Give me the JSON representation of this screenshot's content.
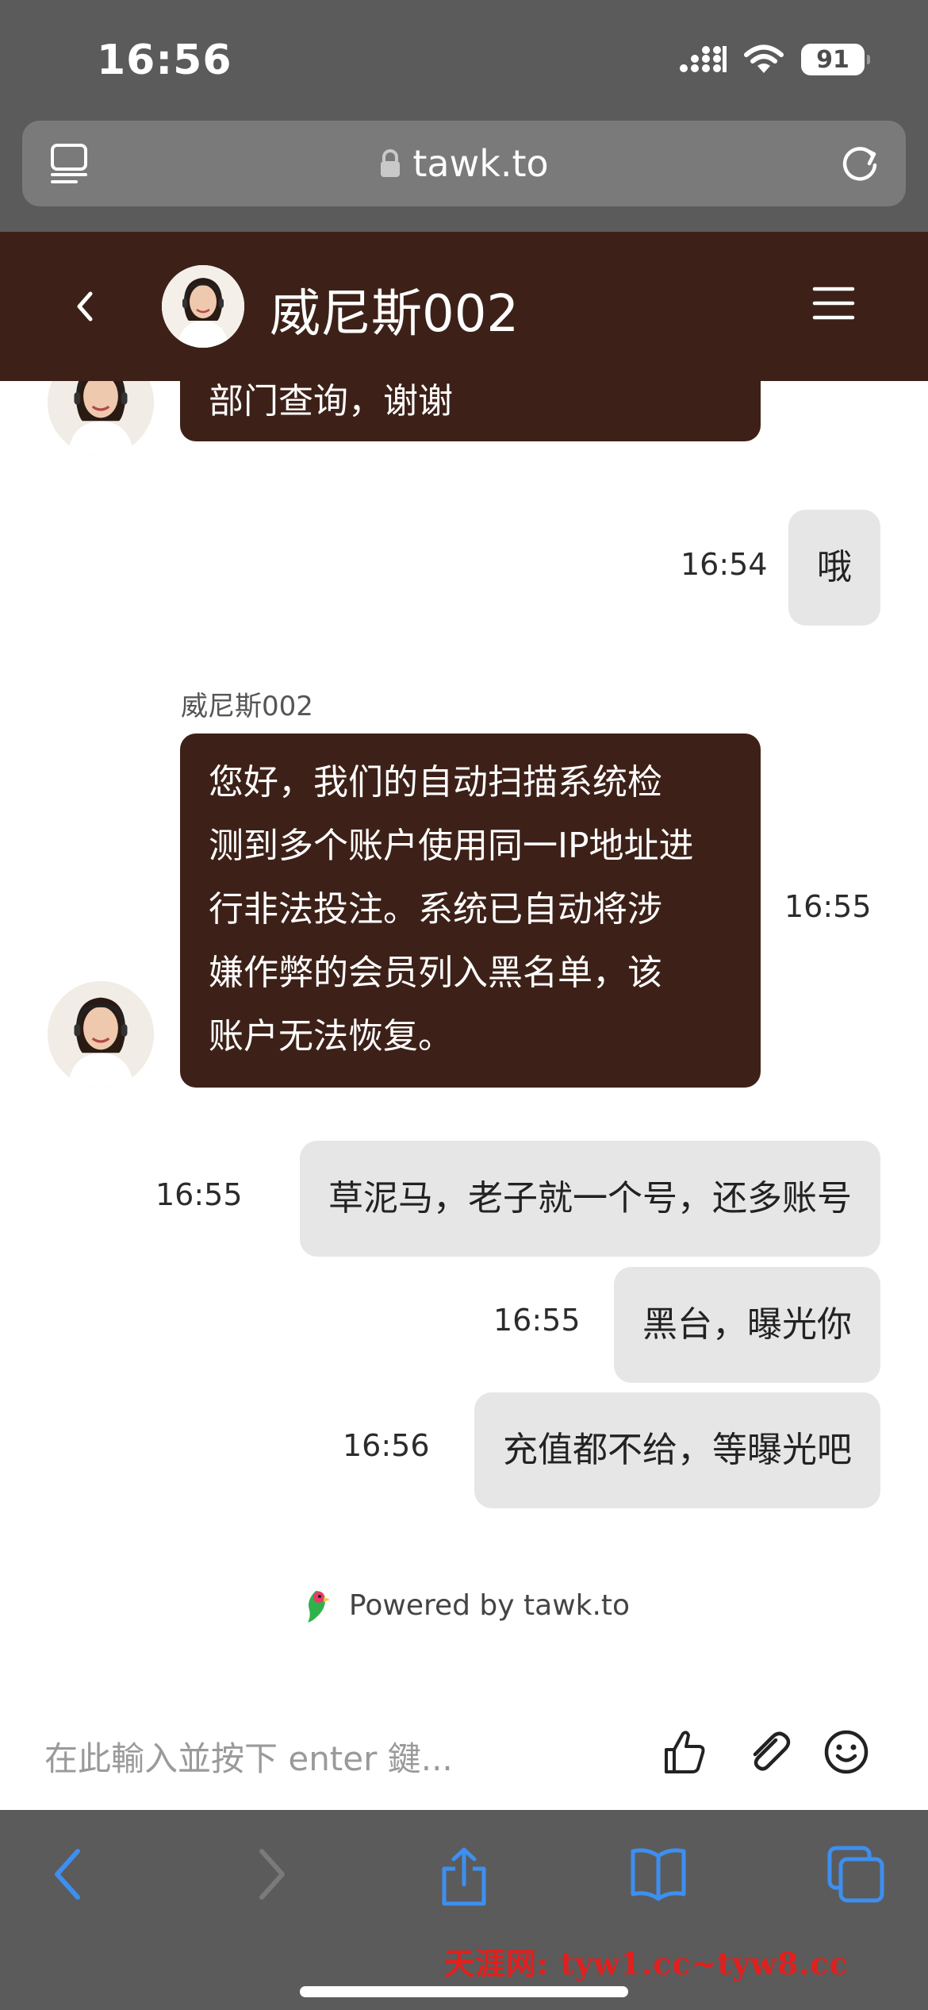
{
  "status_bar": {
    "time": "16:56",
    "battery": "91"
  },
  "browser": {
    "url": "tawk.to"
  },
  "chat": {
    "agent_name": "威尼斯002",
    "agent_label": "威尼斯002",
    "messages": [
      {
        "from": "agent",
        "text": "部门查询，谢谢"
      },
      {
        "from": "visitor",
        "time": "16:54",
        "text": "哦"
      },
      {
        "from": "agent",
        "time": "16:55",
        "lines": [
          "您好，我们的自动扫描系统检",
          "测到多个账户使用同一IP地址进",
          "行非法投注。系统已自动将涉",
          "嫌作弊的会员列入黑名单，该",
          "账户无法恢复。"
        ]
      },
      {
        "from": "visitor",
        "time": "16:55",
        "text": "草泥马，老子就一个号，还多账号"
      },
      {
        "from": "visitor",
        "time": "16:55",
        "text": "黑台，曝光你"
      },
      {
        "from": "visitor",
        "time": "16:56",
        "text": "充值都不给，等曝光吧"
      }
    ],
    "powered_by": "Powered by tawk.to",
    "input_placeholder": "在此輸入並按下 enter 鍵..."
  },
  "watermark": "天涯网: tyw1.cc~tyw8.cc",
  "colors": {
    "header_bg": "#3d2118",
    "agent_bubble": "#3d2118",
    "visitor_bubble": "#e6e6e6",
    "browser_chrome": "#5b5b5b",
    "safari_blue": "#3d8ff0",
    "watermark": "#e0201e"
  },
  "icons": {
    "back": "chevron-left-icon",
    "menu": "hamburger-menu-icon",
    "like": "thumbs-up-icon",
    "attach": "paperclip-icon",
    "emoji": "smiley-icon",
    "share": "share-icon",
    "bookmarks": "book-icon",
    "tabs": "tabs-icon"
  }
}
